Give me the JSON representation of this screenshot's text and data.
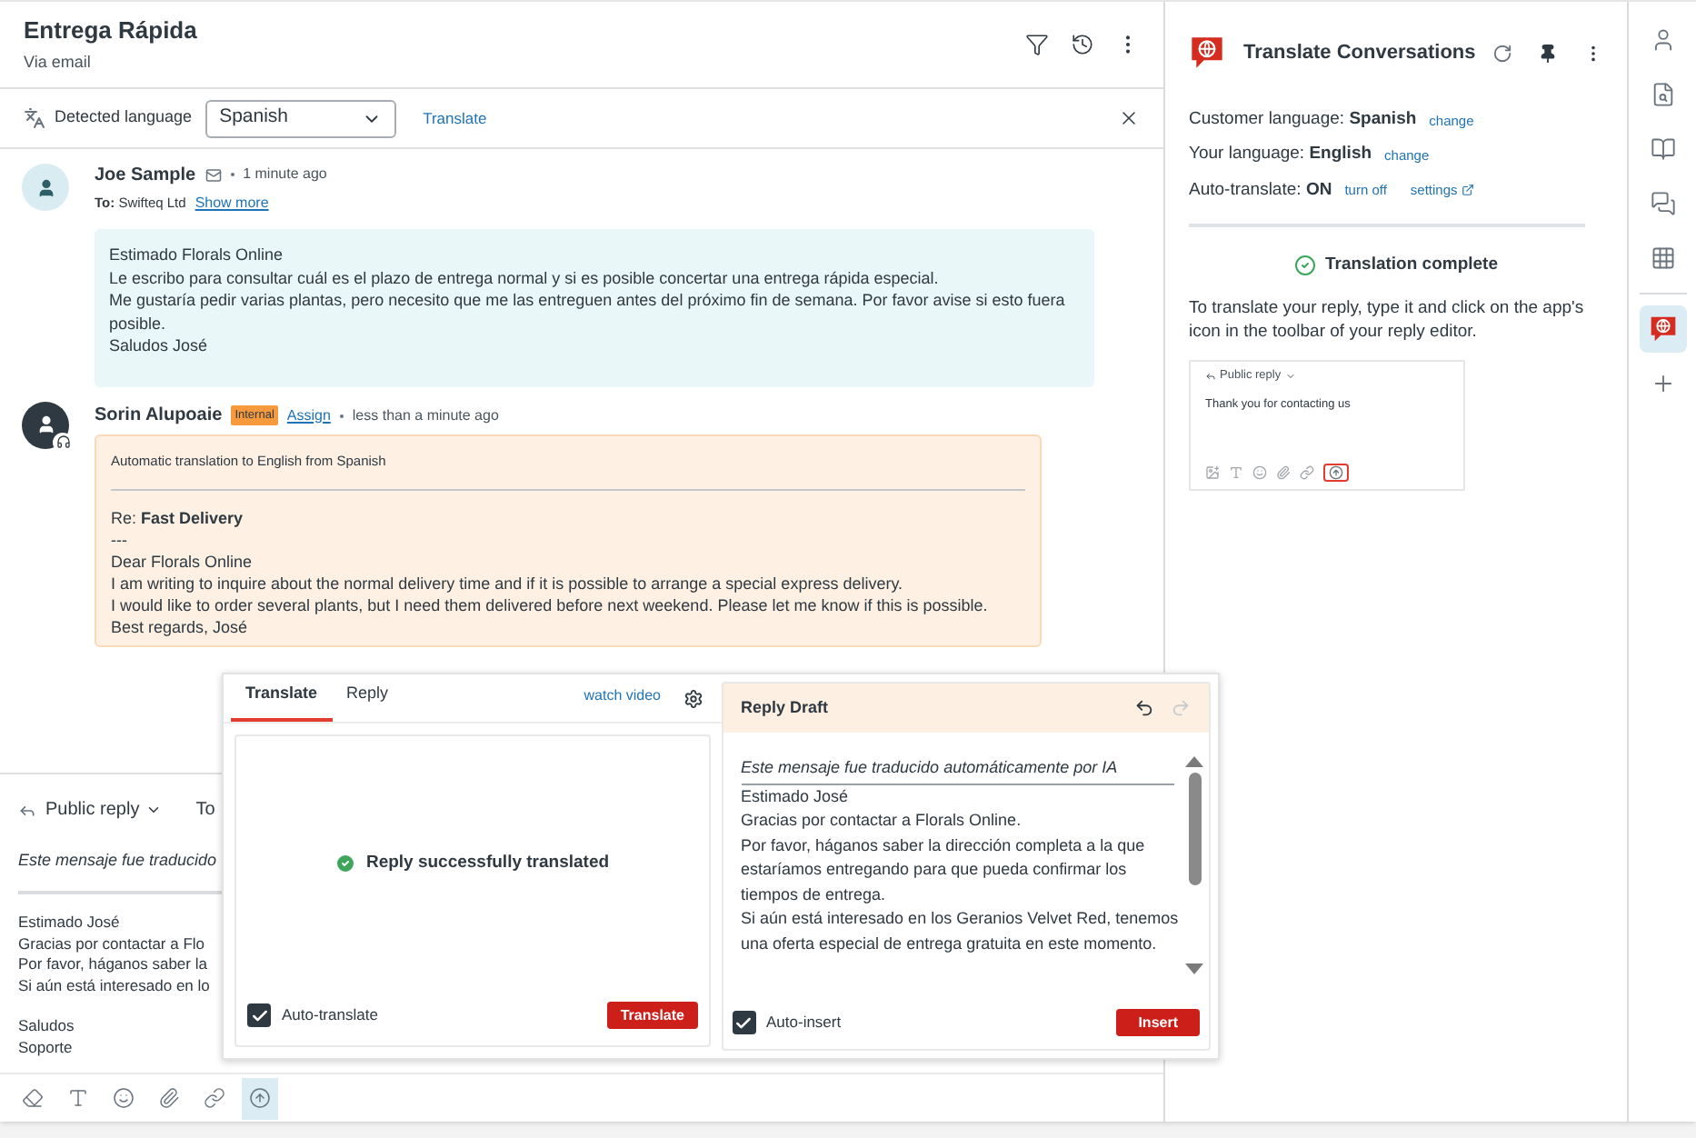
{
  "conversation": {
    "title": "Entrega Rápida",
    "subtitle": "Via email"
  },
  "language_bar": {
    "label": "Detected language",
    "language": "Spanish",
    "translate_link": "Translate"
  },
  "messages": [
    {
      "kind": "customer",
      "author": "Joe Sample",
      "time": "1 minute ago",
      "to_label": "To:",
      "to": "Swifteq Ltd",
      "show_more": "Show more",
      "body": [
        "Estimado Florals Online",
        "Le escribo para consultar cuál es el plazo de entrega normal y si es posible concertar una entrega rápida especial.",
        "Me gustaría pedir varias plantas, pero necesito que me las entreguen antes del próximo fin de semana. Por favor avise si esto fuera posible.",
        "Saludos José"
      ]
    },
    {
      "kind": "internal",
      "author": "Sorin Alupoaie",
      "badge": "Internal",
      "assign": "Assign",
      "time": "less than a minute ago",
      "note": "Automatic translation to English from Spanish",
      "body": [
        "Re: **Fast Delivery**",
        "---",
        "Dear Florals Online",
        "I am writing to inquire about the normal delivery time and if it is possible to arrange a special express delivery.",
        "I would like to order several plants, but I need them delivered before next weekend. Please let me know if this is possible.",
        "Best regards, José"
      ]
    }
  ],
  "reply_editor": {
    "reply_type": "Public reply",
    "to_label": "To",
    "notice": "Este mensaje fue traducido",
    "paragraphs": [
      [
        "Estimado José",
        "Gracias por contactar a Flo",
        "Por favor, háganos saber la",
        "Si aún está interesado en lo"
      ],
      [
        "Saludos",
        "Soporte"
      ]
    ],
    "toolbar": [
      {
        "kind": "eraser",
        "active": false
      },
      {
        "kind": "text",
        "active": false
      },
      {
        "kind": "emoji",
        "active": false
      },
      {
        "kind": "attach",
        "active": false
      },
      {
        "kind": "link",
        "active": false
      },
      {
        "kind": "app",
        "active": true
      }
    ]
  },
  "popup": {
    "tabs": [
      {
        "label": "Translate",
        "selected": true
      },
      {
        "label": "Reply",
        "selected": false
      }
    ],
    "watch_video": "watch video",
    "status": "Reply successfully translated",
    "auto_translate": {
      "label": "Auto-translate",
      "checked": true
    },
    "button": "Translate",
    "draft": {
      "title": "Reply Draft",
      "undo_disabled": false,
      "redo_disabled": true,
      "notice": "Este mensaje fue traducido automáticamente por IA",
      "lines": [
        "Estimado José",
        "Gracias por contactar a Florals Online.",
        "Por favor, háganos saber la dirección completa a la que estaríamos entregando para que pueda confirmar los tiempos de entrega.",
        "Si aún está interesado en los Geranios Velvet Red, tenemos una oferta especial de entrega gratuita en este momento."
      ],
      "auto_insert": {
        "label": "Auto-insert",
        "checked": true
      },
      "button": "Insert"
    }
  },
  "app_panel": {
    "title": "Translate Conversations",
    "settings": [
      {
        "label": "Customer language:",
        "value": "Spanish",
        "links": [
          "change"
        ]
      },
      {
        "label": "Your language:",
        "value": "English",
        "links": [
          "change"
        ]
      },
      {
        "label": "Auto-translate:",
        "value": "ON",
        "links": [
          "turn off",
          "settings"
        ]
      }
    ],
    "status": "Translation complete",
    "hint": "To translate your reply, type it and click on the app's icon in the toolbar of your reply editor.",
    "preview": {
      "reply_type": "Public reply",
      "text": "Thank you for contacting us"
    }
  },
  "rail": [
    {
      "kind": "person",
      "selected": false
    },
    {
      "kind": "doc-search",
      "selected": false
    },
    {
      "kind": "book",
      "selected": false
    },
    {
      "kind": "chat",
      "selected": false
    },
    {
      "kind": "grid",
      "selected": false
    },
    {
      "kind": "app",
      "selected": true
    },
    {
      "kind": "add",
      "selected": false
    }
  ]
}
